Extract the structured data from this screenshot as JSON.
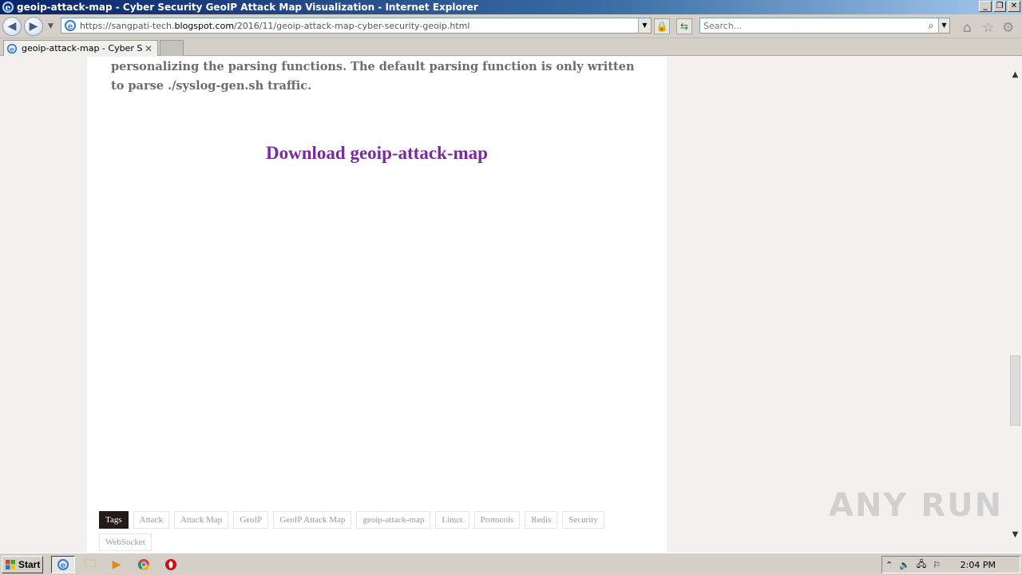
{
  "window": {
    "title": "geoip-attack-map - Cyber Security GeoIP Attack Map Visualization - Internet Explorer"
  },
  "address": {
    "scheme": "https://",
    "sub": "sangpati-tech.",
    "host": "blogspot.com",
    "path": "/2016/11/geoip-attack-map-cyber-security-geoip.html"
  },
  "search": {
    "placeholder": "Search..."
  },
  "tab": {
    "label": "geoip-attack-map - Cyber Se..."
  },
  "post": {
    "paragraph": "personalizing the parsing functions. The default parsing function is only written to parse ./syslog-gen.sh traffic.",
    "download_link": "Download geoip-attack-map",
    "tags_heading": "Tags",
    "tags": [
      "Attack",
      "Attack Map",
      "GeoIP",
      "GeoIP Attack Map",
      "geoip-attack-map",
      "Linux",
      "Protocols",
      "Redis",
      "Security",
      "WebSocket"
    ]
  },
  "watermark": "ANY RUN",
  "taskbar": {
    "start": "Start",
    "clock": "2:04 PM"
  },
  "colors": {
    "link": "#7a2a9e",
    "body_text": "#6c6c6c",
    "tag_head_bg": "#231a1a"
  }
}
